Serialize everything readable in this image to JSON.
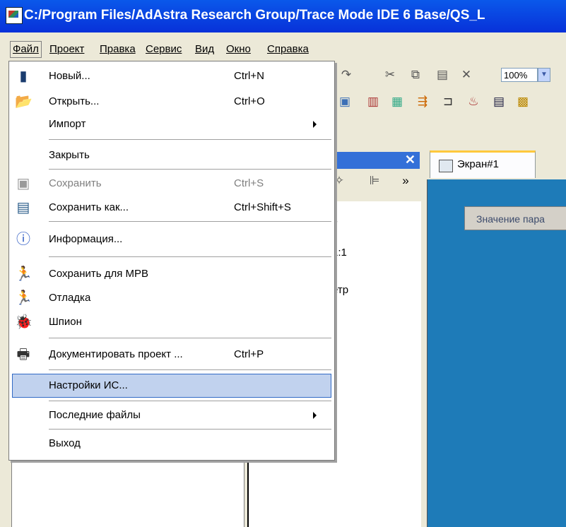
{
  "window": {
    "title": "C:/Program Files/AdAstra Research Group/Trace Mode IDE 6 Base/QS_L"
  },
  "menubar": {
    "items": [
      "Файл",
      "Проект",
      "Правка",
      "Сервис",
      "Вид",
      "Окно",
      "Справка"
    ]
  },
  "toolbar": {
    "zoom": "100%"
  },
  "panel": {
    "close": "✕",
    "more": "»"
  },
  "tree": {
    "visible_fragments": [
      "ь",
      "1:1",
      "етр"
    ]
  },
  "tab": {
    "label": "Экран#1"
  },
  "canvas": {
    "value_box": "Значение пара"
  },
  "file_menu": {
    "items": [
      {
        "label": "Новый...",
        "shortcut": "Ctrl+N",
        "icon": "new-document-icon"
      },
      {
        "label": "Открыть...",
        "shortcut": "Ctrl+O",
        "icon": "open-folder-icon"
      },
      {
        "label": "Импорт",
        "shortcut": "",
        "submenu": true
      },
      {
        "label": "Закрыть",
        "shortcut": ""
      },
      {
        "label": "Сохранить",
        "shortcut": "Ctrl+S",
        "icon": "save-icon",
        "disabled": true
      },
      {
        "label": "Сохранить как...",
        "shortcut": "Ctrl+Shift+S",
        "icon": "save-as-icon"
      },
      {
        "label": "Информация...",
        "shortcut": "",
        "icon": "info-icon"
      },
      {
        "label": "Сохранить для МРВ",
        "shortcut": "",
        "icon": "save-for-runtime-icon"
      },
      {
        "label": "Отладка",
        "shortcut": "",
        "icon": "debug-runner-icon"
      },
      {
        "label": "Шпион",
        "shortcut": "",
        "icon": "spy-bug-icon"
      },
      {
        "label": "Документировать проект ...",
        "shortcut": "Ctrl+P",
        "icon": "printer-icon"
      },
      {
        "label": "Настройки ИС...",
        "shortcut": "",
        "highlighted": true
      },
      {
        "label": "Последние файлы",
        "shortcut": "",
        "submenu": true
      },
      {
        "label": "Выход",
        "shortcut": ""
      }
    ]
  }
}
